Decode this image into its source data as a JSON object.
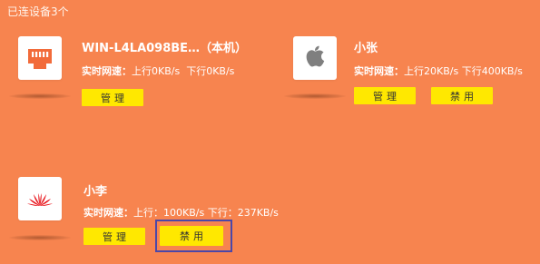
{
  "header": {
    "connected_count_text": "已连设备3个"
  },
  "devices": [
    {
      "name": "WIN-L4LA098BE…（本机）",
      "icon": "ethernet-port-icon",
      "speed_label": "实时网速：",
      "up": "上行0KB/s",
      "down": "下行0KB/s",
      "manage_label": "管理"
    },
    {
      "name": "小张",
      "icon": "apple-logo-icon",
      "speed_label": "实时网速：",
      "up": "上行20KB/s",
      "down": "下行400KB/s",
      "manage_label": "管理",
      "block_label": "禁用"
    },
    {
      "name": "小李",
      "icon": "huawei-logo-icon",
      "speed_label": "实时网速：",
      "up": "上行：100KB/s",
      "down": "下行：237KB/s",
      "manage_label": "管理",
      "block_label": "禁用"
    }
  ],
  "colors": {
    "background": "#f7844f",
    "button": "#ffe800",
    "focus_ring": "#4b47a8",
    "port_icon": "#f26b3a",
    "apple_icon": "#7f7f7f",
    "huawei_icon": "#e8141b"
  }
}
